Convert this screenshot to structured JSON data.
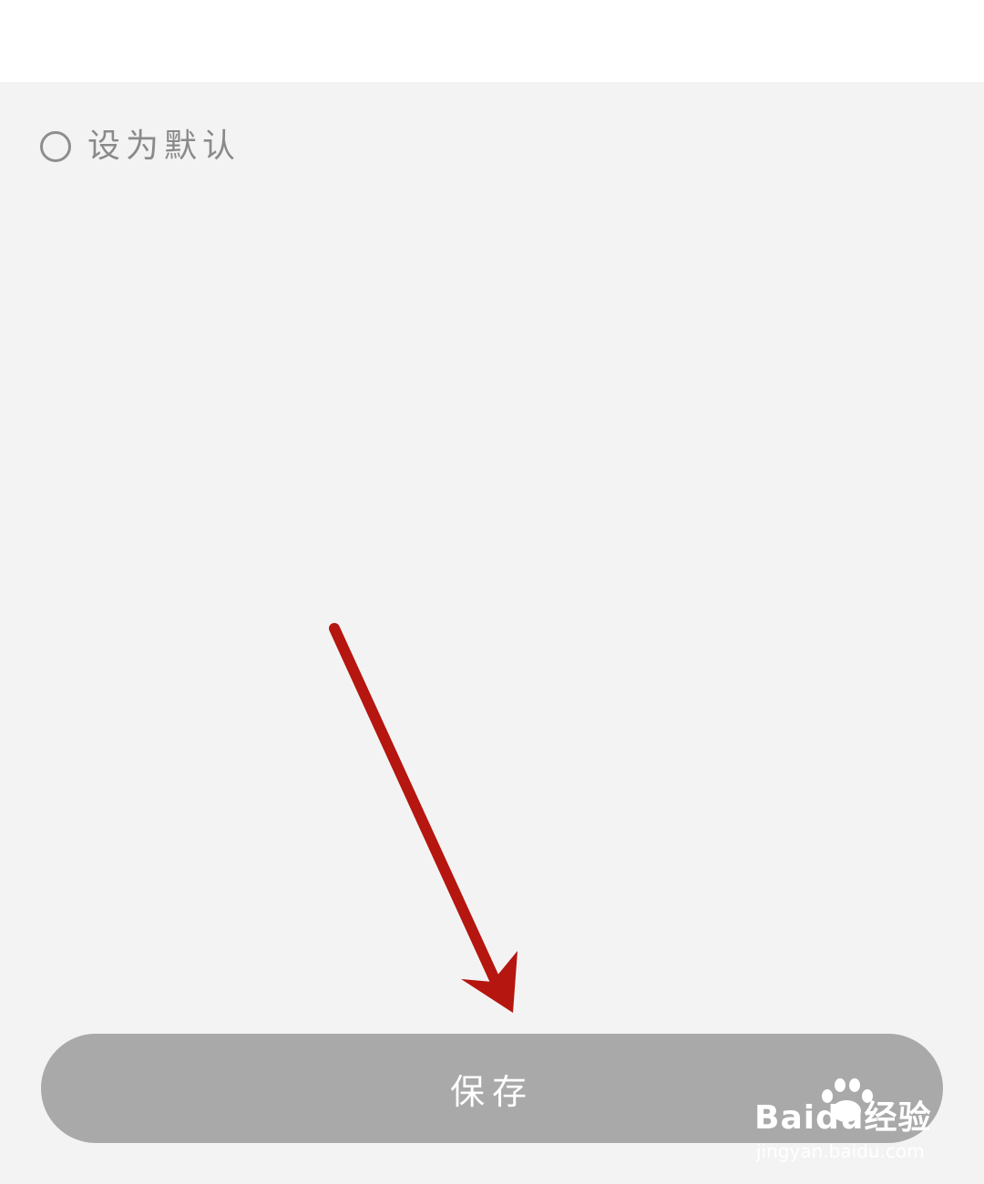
{
  "form": {
    "default_option_label": "设为默认",
    "default_option_checked": false
  },
  "footer": {
    "save_label": "保存"
  },
  "annotation": {
    "arrow_color": "#b5160f",
    "arrow_icon": "red-arrow-icon"
  },
  "watermark": {
    "brand": "Baidu经验",
    "url": "jingyan.baidu.com"
  },
  "colors": {
    "background": "#f4f3f4",
    "header": "#ffffff",
    "button": "#a9a9a9",
    "text_gray": "#8a8a8a"
  }
}
